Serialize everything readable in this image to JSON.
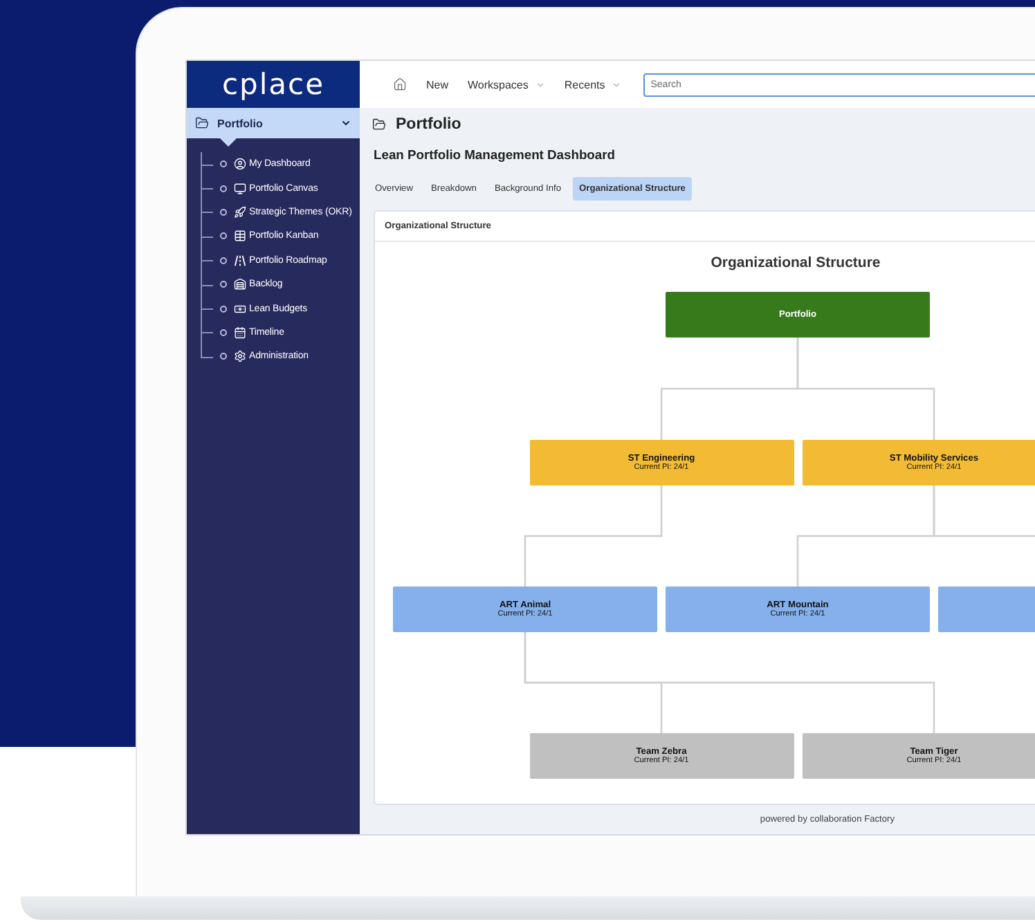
{
  "logo": "cplace",
  "sidebar": {
    "header": {
      "label": "Portfolio",
      "expanded": true,
      "children": [
        {
          "label": "My Dashboard"
        },
        {
          "label": "Portfolio Canvas"
        },
        {
          "label": "Strategic Themes (OKR)"
        },
        {
          "label": "Portfolio Kanban"
        },
        {
          "label": "Portfolio Roadmap"
        },
        {
          "label": "Backlog"
        },
        {
          "label": "Lean Budgets"
        },
        {
          "label": "Timeline"
        },
        {
          "label": "Administration"
        }
      ]
    }
  },
  "topbar": {
    "nav": [
      {
        "label": "New",
        "has_menu": false
      },
      {
        "label": "Workspaces",
        "has_menu": true
      },
      {
        "label": "Recents",
        "has_menu": true
      }
    ],
    "search": {
      "placeholder": "Search"
    }
  },
  "page": {
    "title": "Portfolio",
    "subtitle": "Lean Portfolio Management Dashboard"
  },
  "tabs": [
    {
      "label": "Overview",
      "selected": false
    },
    {
      "label": "Breakdown",
      "selected": false
    },
    {
      "label": "Background Info",
      "selected": false
    },
    {
      "label": "Organizational Structure",
      "selected": true
    }
  ],
  "card": {
    "title": "Organizational Structure",
    "chart_title": "Organizational Structure",
    "org_chart": {
      "kind": "portfolio",
      "name": "Portfolio",
      "children": [
        {
          "kind": "st",
          "name": "ST Engineering",
          "detail": "Current PI: 24/1",
          "children": [
            {
              "kind": "art",
              "name": "ART Animal",
              "detail": "Current PI: 24/1",
              "children": [
                {
                  "kind": "team",
                  "name": "Team Zebra",
                  "detail": "Current PI: 24/1"
                },
                {
                  "kind": "team",
                  "name": "Team Tiger",
                  "detail": "Current PI: 24/1"
                }
              ]
            }
          ]
        },
        {
          "kind": "st",
          "name": "ST Mobility Services",
          "detail": "Current PI: 24/1",
          "children": [
            {
              "kind": "art",
              "name": "ART Mountain",
              "detail": "Current PI: 24/1"
            },
            {
              "kind": "art"
            }
          ]
        }
      ]
    }
  },
  "footer": "powered by collaboration Factory"
}
